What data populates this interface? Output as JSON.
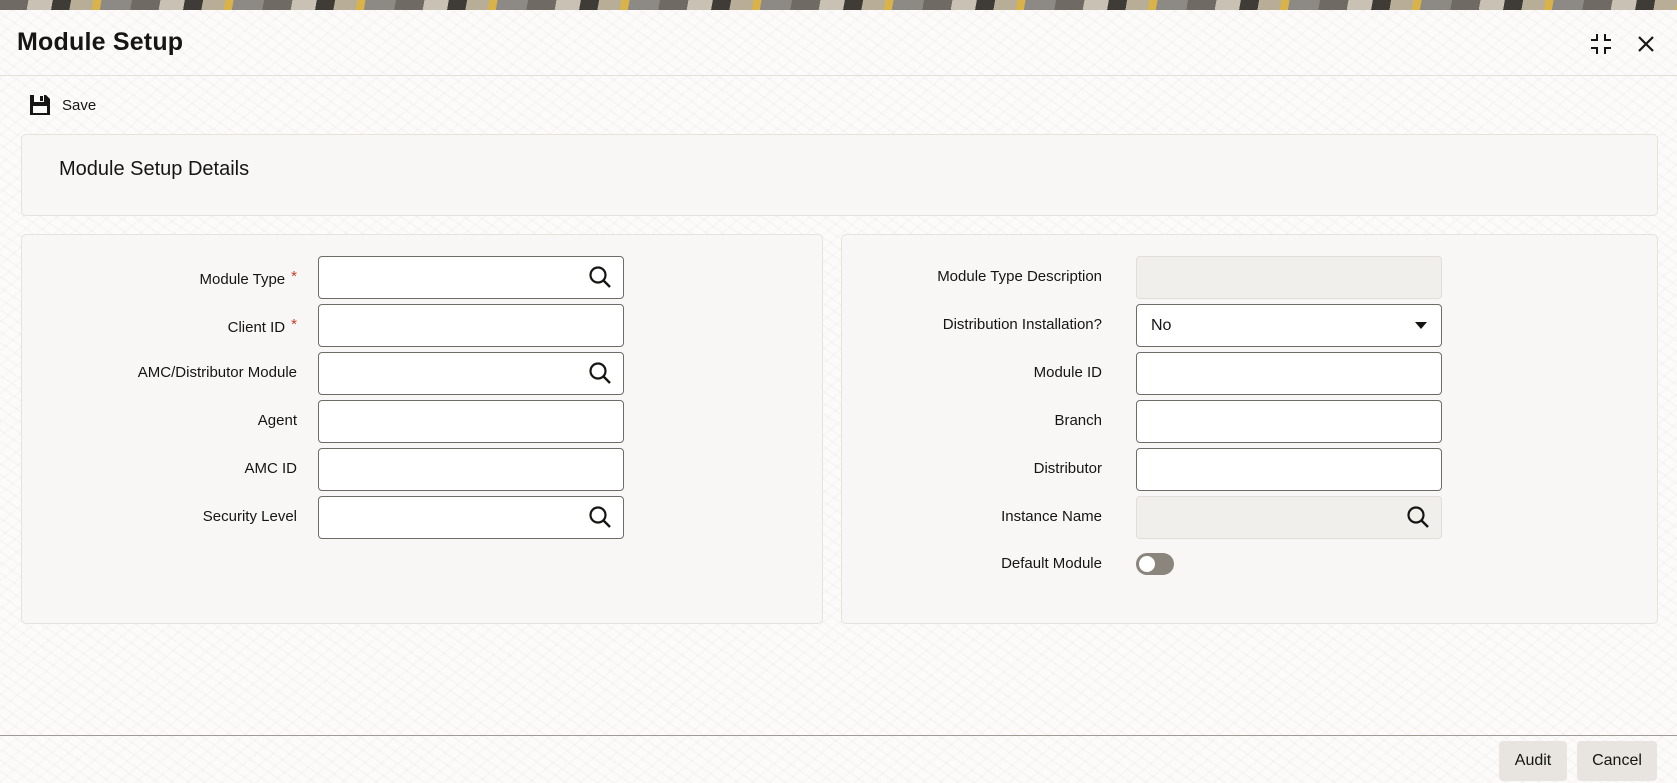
{
  "window": {
    "title": "Module Setup",
    "maximize_icon": "maximize-icon",
    "close_icon": "close-icon"
  },
  "toolbar": {
    "save_label": "Save",
    "save_icon": "floppy-disk-icon"
  },
  "section": {
    "title": "Module Setup Details"
  },
  "left_fields": {
    "module_type": {
      "label": "Module Type",
      "required": "*",
      "value": ""
    },
    "client_id": {
      "label": "Client ID",
      "required": "*",
      "value": ""
    },
    "amc_distributor_module": {
      "label": "AMC/Distributor Module",
      "value": ""
    },
    "agent": {
      "label": "Agent",
      "value": ""
    },
    "amc_id": {
      "label": "AMC ID",
      "value": ""
    },
    "security_level": {
      "label": "Security Level",
      "value": ""
    }
  },
  "right_fields": {
    "module_type_description": {
      "label": "Module Type Description",
      "value": ""
    },
    "distribution_installation": {
      "label": "Distribution Installation?",
      "selected": "No"
    },
    "module_id": {
      "label": "Module ID",
      "value": ""
    },
    "branch": {
      "label": "Branch",
      "value": ""
    },
    "distributor": {
      "label": "Distributor",
      "value": ""
    },
    "instance_name": {
      "label": "Instance Name",
      "value": ""
    },
    "default_module": {
      "label": "Default Module",
      "on": false
    }
  },
  "footer": {
    "audit_label": "Audit",
    "cancel_label": "Cancel"
  },
  "colors": {
    "required": "#c0392b",
    "toggle_off": "#8b857e",
    "footer_button": "#e8e5e0"
  }
}
